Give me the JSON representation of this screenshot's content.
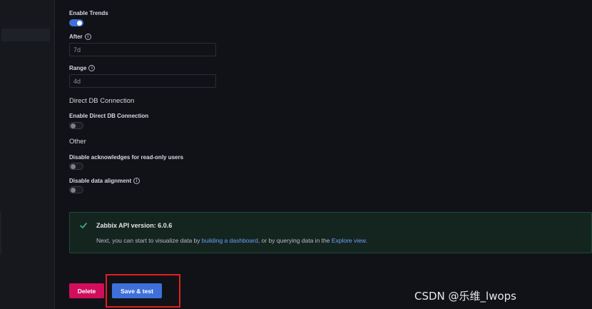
{
  "trends": {
    "enable_label": "Enable Trends",
    "enabled": true,
    "after_label": "After",
    "after_value": "7d",
    "range_label": "Range",
    "range_value": "4d"
  },
  "direct_db": {
    "section_title": "Direct DB Connection",
    "enable_label": "Enable Direct DB Connection",
    "enabled": false
  },
  "other": {
    "section_title": "Other",
    "disable_ack_label": "Disable acknowledges for read-only users",
    "disable_ack_enabled": false,
    "disable_alignment_label": "Disable data alignment",
    "disable_alignment_enabled": false
  },
  "alert": {
    "title": "Zabbix API version: 6.0.6",
    "body_prefix": "Next, you can start to visualize data by ",
    "link_dashboard": "building a dashboard",
    "body_middle": ", or by querying data in the ",
    "link_explore": "Explore view",
    "body_suffix": ".",
    "color_border": "#1c4a36",
    "color_check": "#3fbf7f"
  },
  "actions": {
    "delete_label": "Delete",
    "save_label": "Save & test",
    "delete_color": "#d10e5c",
    "save_color": "#3d71d9"
  },
  "watermark": "CSDN @乐维_lwops",
  "icons": {
    "info": "info-circle-icon",
    "check": "check-icon"
  }
}
